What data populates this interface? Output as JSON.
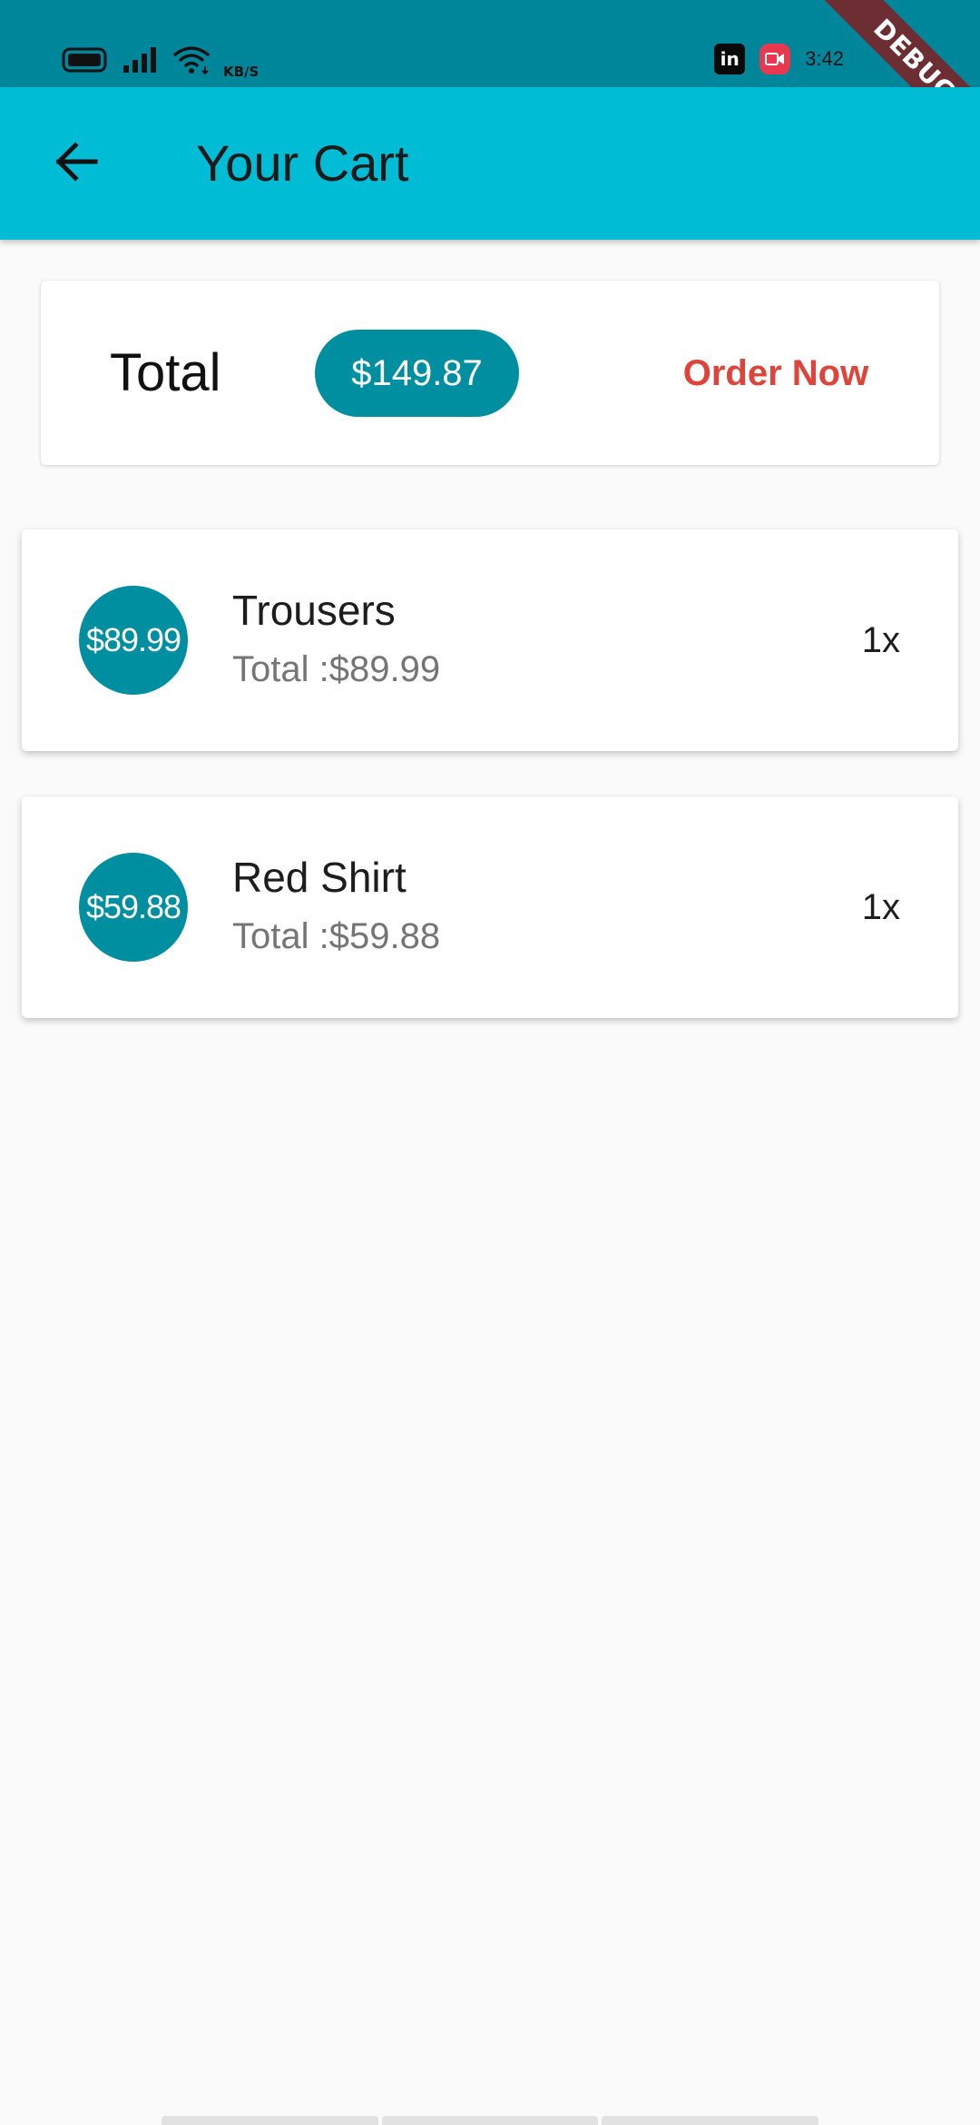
{
  "status_bar": {
    "speed_unit": "KB/S",
    "time": "3:42",
    "icons": [
      "battery-icon",
      "signal-icon",
      "wifi-icon",
      "linkedin-icon",
      "screen-record-icon"
    ]
  },
  "debug_banner": "DEBUG",
  "app_bar": {
    "back_icon": "arrow-left-icon",
    "title": "Your Cart"
  },
  "summary": {
    "total_label": "Total",
    "total_amount": "$149.87",
    "order_button_label": "Order Now"
  },
  "items": [
    {
      "avatar_price": "$89.99",
      "title": "Trousers",
      "subtotal": "Total :$89.99",
      "quantity": "1x"
    },
    {
      "avatar_price": "$59.88",
      "title": "Red Shirt",
      "subtotal": "Total :$59.88",
      "quantity": "1x"
    }
  ],
  "colors": {
    "status_bar": "#00869b",
    "app_bar": "#00bcd4",
    "accent": "#008fa1",
    "order_button": "#e0433a",
    "background": "#fafafa"
  }
}
